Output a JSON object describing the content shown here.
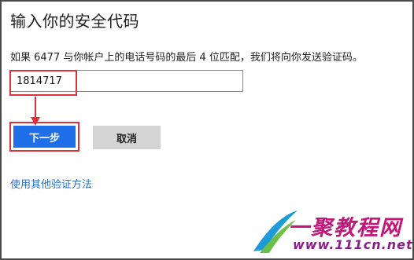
{
  "dialog": {
    "title": "输入你的安全代码",
    "description": "如果 6477 与你帐户上的电话号码的最后 4 位匹配，我们将向你发送验证码。",
    "code_value": "1814717",
    "next_label": "下一步",
    "cancel_label": "取消",
    "alt_link": "使用其他验证方法"
  },
  "watermark": {
    "logo_text": "一聚教程网",
    "domain": "www.111cn.net"
  },
  "colors": {
    "primary_button": "#1f6fe8",
    "highlight": "#d9323a",
    "link": "#2a6fc9",
    "cancel_button": "#d4d4d4"
  }
}
